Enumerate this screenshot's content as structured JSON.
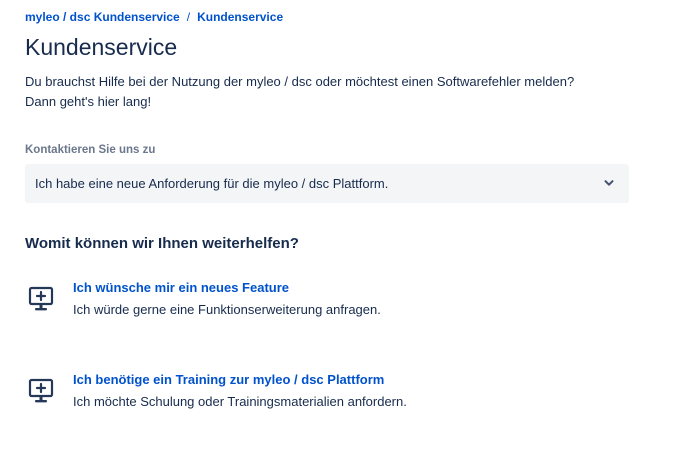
{
  "breadcrumb": {
    "items": [
      "myleo / dsc Kundenservice",
      "Kundenservice"
    ],
    "separator": "/"
  },
  "page": {
    "title": "Kundenservice",
    "intro_line1": "Du brauchst Hilfe bei der Nutzung der myleo / dsc oder möchtest einen Softwarefehler melden?",
    "intro_line2": "Dann geht's hier lang!"
  },
  "contact": {
    "label": "Kontaktieren Sie uns zu",
    "selected_value": "Ich habe eine neue Anforderung für die myleo / dsc Plattform."
  },
  "help": {
    "heading": "Womit können wir Ihnen weiterhelfen?",
    "request_types": [
      {
        "title": "Ich wünsche mir ein neues Feature",
        "description": "Ich würde gerne eine Funktionserweiterung anfragen.",
        "icon": "monitor-plus-icon"
      },
      {
        "title": "Ich benötige ein Training zur myleo / dsc Plattform",
        "description": "Ich möchte Schulung oder Trainingsmaterialien anfordern.",
        "icon": "monitor-plus-icon"
      }
    ]
  },
  "colors": {
    "link": "#0052cc",
    "text": "#172b4d",
    "muted": "#6b778c",
    "select_bg": "#f4f5f7"
  }
}
